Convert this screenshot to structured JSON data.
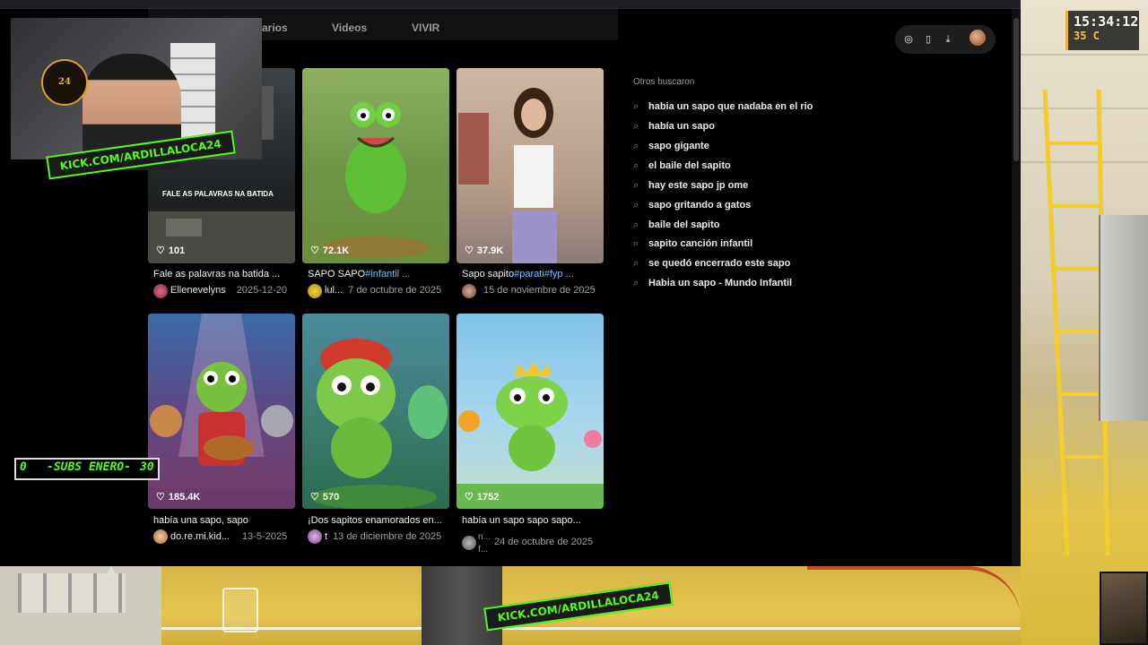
{
  "overlay": {
    "clock_time": "15:34:12",
    "temperature": "35 C",
    "kick_url_top": "KICK.COM/ARDILLALOCA24",
    "kick_url_bottom": "KICK.COM/ARDILLALOCA24",
    "subs_current": "0",
    "subs_label": "-SUBS ENERO-",
    "subs_goal": "30"
  },
  "tabs": [
    {
      "label": "arios"
    },
    {
      "label": "Videos"
    },
    {
      "label": "VIVIR"
    }
  ],
  "toolbar_icons": [
    "compass-icon",
    "phone-icon",
    "download-icon",
    "profile-avatar"
  ],
  "videos": [
    {
      "caption_overlay": "FALE AS PALAVRAS NA BATIDA",
      "likes": "101",
      "title": "Fale as palavras na batida ...",
      "title_tag": "",
      "author": "Ellenevelyns",
      "date": "2025-12-20"
    },
    {
      "caption_overlay": "",
      "likes": "72.1K",
      "title": "SAPO SAPO",
      "title_tag": "#infantil ...",
      "author": "lul...",
      "date": "7 de octubre de 2025"
    },
    {
      "caption_overlay": "",
      "likes": "37.9K",
      "title": "Sapo sapito",
      "title_tag": "#parati#fyp ...",
      "author": "",
      "date": "15 de noviembre de 2025"
    },
    {
      "caption_overlay": "",
      "likes": "185.4K",
      "title": "había una sapo, sapo",
      "title_tag": "",
      "author": "do.re.mi.kid...",
      "date": "13-5-2025"
    },
    {
      "caption_overlay": "",
      "likes": "570",
      "title": "¡Dos sapitos enamorados en...",
      "title_tag": "",
      "author": "t",
      "date": "13 de diciembre de 2025"
    },
    {
      "caption_overlay": "",
      "likes": "1752",
      "title": "había un sapo sapo sapo...",
      "title_tag": "",
      "author": "n... f...",
      "date": "24 de octubre de 2025"
    }
  ],
  "others_searched": {
    "title": "Otros buscaron",
    "items": [
      "habia un sapo que nadaba en el rio",
      "había un sapo",
      "sapo gigante",
      "el baile del sapito",
      "hay este sapo jp ome",
      "sapo gritando a gatos",
      "baile del sapito",
      "sapito canción infantil",
      "se quedó encerrado este sapo",
      "Habia un sapo - Mundo Infantil"
    ]
  }
}
